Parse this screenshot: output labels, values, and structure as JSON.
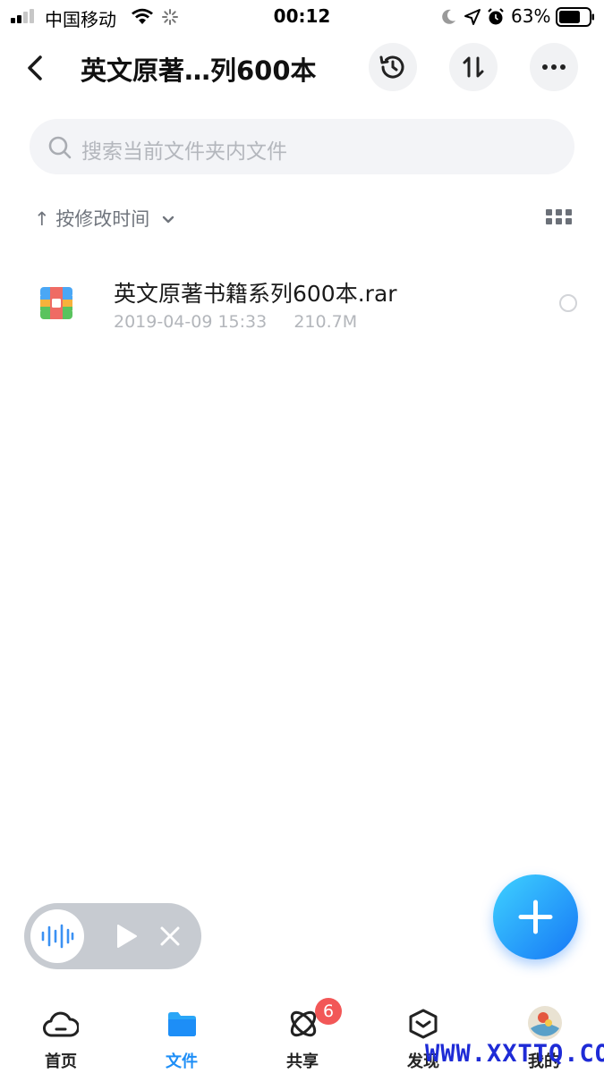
{
  "status_bar": {
    "carrier": "中国移动",
    "time": "00:12",
    "battery": "63%"
  },
  "header": {
    "title": "英文原著…列600本"
  },
  "search": {
    "placeholder": "搜索当前文件夹内文件"
  },
  "sort": {
    "label": "↑ 按修改时间"
  },
  "files": [
    {
      "name": "英文原著书籍系列600本.rar",
      "date": "2019-04-09 15:33",
      "size": "210.7M",
      "icon": "archive-icon"
    }
  ],
  "tabs": [
    {
      "label": "首页",
      "icon": "cloud-home-icon",
      "active": false
    },
    {
      "label": "文件",
      "icon": "folder-icon",
      "active": true
    },
    {
      "label": "共享",
      "icon": "share-orbit-icon",
      "active": false,
      "badge": "6"
    },
    {
      "label": "发现",
      "icon": "discover-box-icon",
      "active": false
    },
    {
      "label": "我的",
      "icon": "avatar",
      "active": false
    }
  ],
  "watermark": "WWW.XXTTQ.COM",
  "colors": {
    "accent": "#1d8ef7",
    "badge": "#f25757",
    "search_bg": "#f3f4f7"
  }
}
